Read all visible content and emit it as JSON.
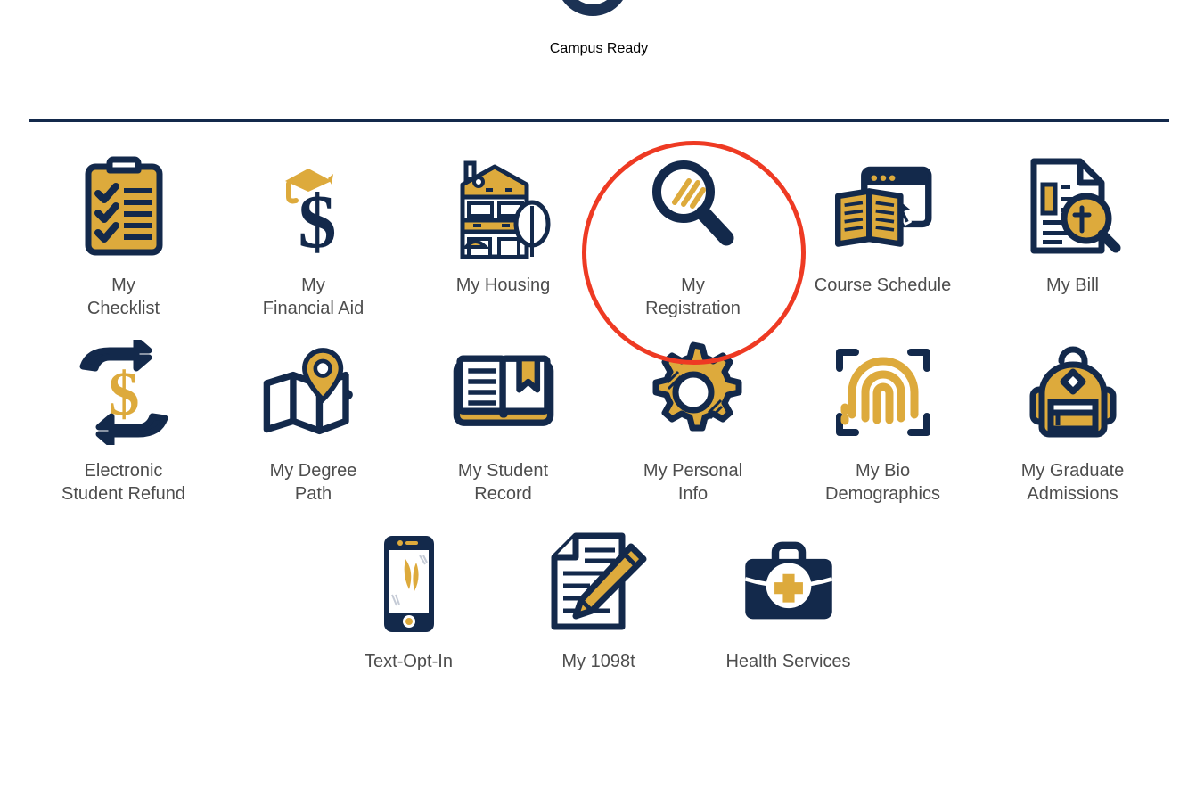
{
  "page": {
    "background_color": "#FFFFFF",
    "brand_navy": "#13294B",
    "brand_gold": "#DDAA3C",
    "label_text_color": "#4D4D4D",
    "annotation_color": "#EE3A23"
  },
  "top_partial_tile": {
    "label": "Campus Ready",
    "icon": "circle-outline-icon",
    "note": "icon cropped at top of viewport"
  },
  "divider": {
    "name": "section-divider",
    "color": "#13294B"
  },
  "annotation": {
    "name": "red-highlight-circle",
    "shape": "circle",
    "color": "#EE3A23",
    "targets": "My Registration"
  },
  "tiles": {
    "row1": [
      {
        "label": "My\nChecklist",
        "icon": "clipboard-checklist-icon"
      },
      {
        "label": "My\nFinancial Aid",
        "icon": "graduation-cap-dollar-icon"
      },
      {
        "label": "My Housing",
        "icon": "house-icon"
      },
      {
        "label": "My\nRegistration",
        "icon": "magnifying-glass-icon",
        "highlighted": true
      },
      {
        "label": "Course Schedule",
        "icon": "book-browser-window-icon"
      },
      {
        "label": "My Bill",
        "icon": "document-magnifier-icon"
      }
    ],
    "row2": [
      {
        "label": "Electronic\nStudent Refund",
        "icon": "refund-arrows-dollar-icon"
      },
      {
        "label": "My Degree\nPath",
        "icon": "map-pin-icon"
      },
      {
        "label": "My Student\nRecord",
        "icon": "open-book-bookmark-icon"
      },
      {
        "label": "My Personal\nInfo",
        "icon": "gear-icon"
      },
      {
        "label": "My Bio\nDemographics",
        "icon": "fingerprint-scan-icon"
      },
      {
        "label": "My Graduate\nAdmissions",
        "icon": "backpack-icon"
      }
    ],
    "row3": [
      {
        "label": "Text-Opt-In",
        "icon": "smartphone-icon"
      },
      {
        "label": "My 1098t",
        "icon": "document-pencil-icon"
      },
      {
        "label": "Health Services",
        "icon": "medical-bag-icon"
      }
    ]
  }
}
